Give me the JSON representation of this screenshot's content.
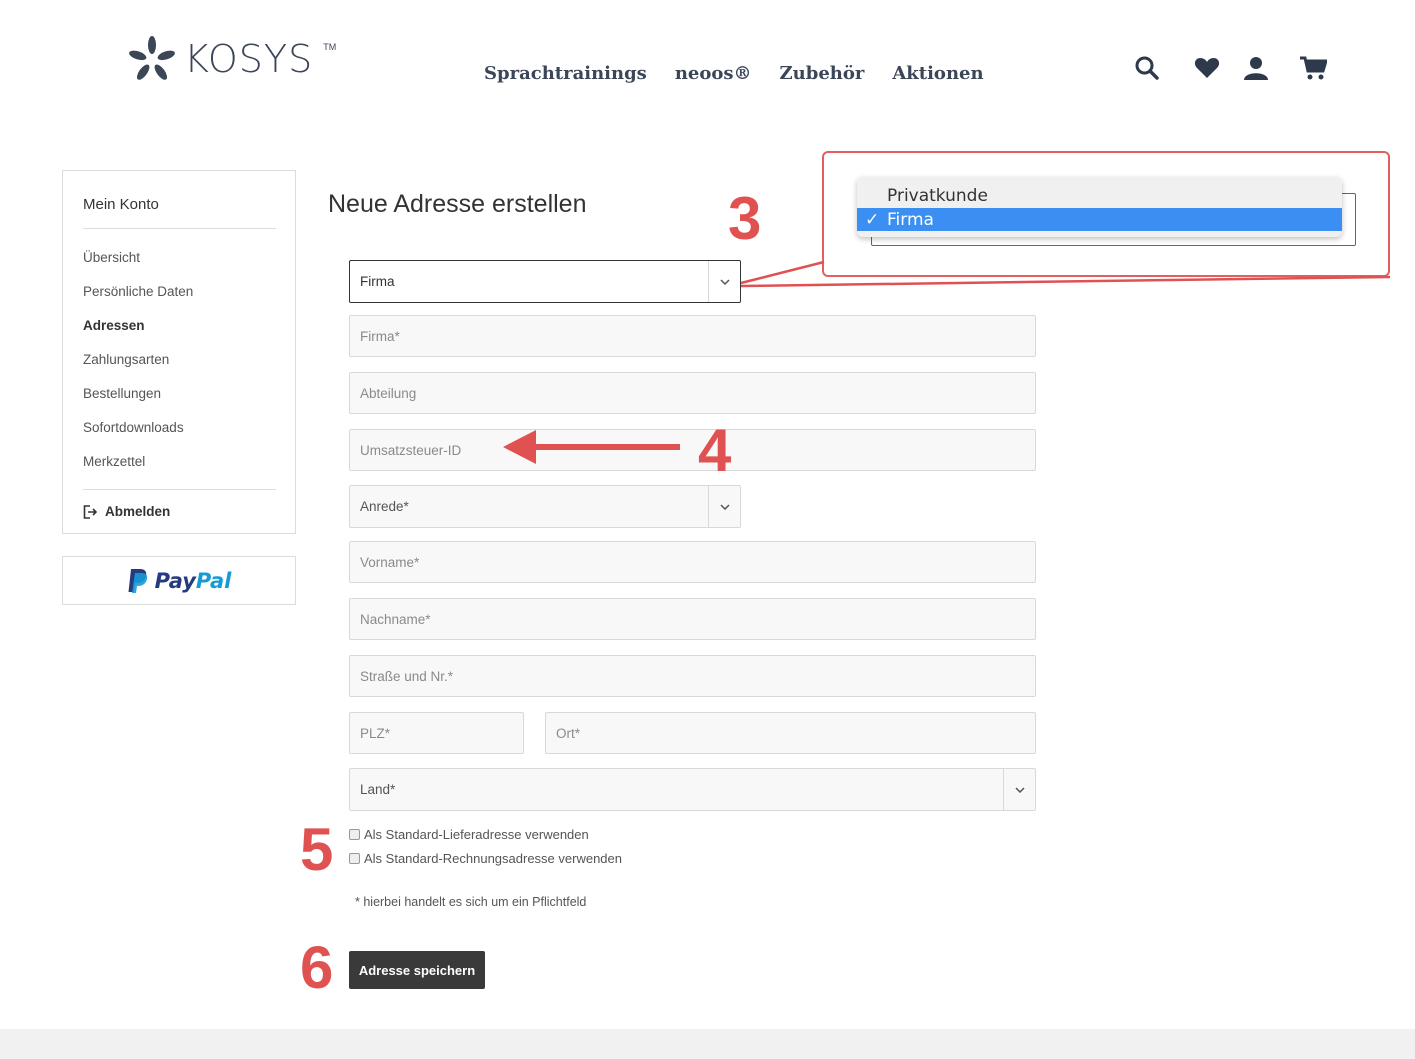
{
  "header": {
    "brand": "KOSYS",
    "brand_tm": "TM",
    "nav": [
      "Sprachtrainings",
      "neoos®",
      "Zubehör",
      "Aktionen"
    ],
    "icons": [
      "search-icon",
      "heart-icon",
      "user-icon",
      "cart-icon"
    ],
    "brand_color": "#3b4657"
  },
  "sidebar": {
    "title": "Mein Konto",
    "items": [
      {
        "label": "Übersicht",
        "active": false
      },
      {
        "label": "Persönliche Daten",
        "active": false
      },
      {
        "label": "Adressen",
        "active": true
      },
      {
        "label": "Zahlungsarten",
        "active": false
      },
      {
        "label": "Bestellungen",
        "active": false
      },
      {
        "label": "Sofortdownloads",
        "active": false
      },
      {
        "label": "Merkzettel",
        "active": false
      }
    ],
    "logout": "Abmelden",
    "paypal": {
      "pay": "Pay",
      "pal": "Pal"
    }
  },
  "form": {
    "title": "Neue Adresse erstellen",
    "customer_type": "Firma",
    "fields": {
      "company": "Firma*",
      "department": "Abteilung",
      "vat_id": "Umsatzsteuer-ID",
      "salutation": "Anrede*",
      "first_name": "Vorname*",
      "last_name": "Nachname*",
      "street": "Straße und Nr.*",
      "zip": "PLZ*",
      "city": "Ort*",
      "country": "Land*"
    },
    "checkbox_shipping": "Als Standard-Lieferadresse verwenden",
    "checkbox_billing": "Als Standard-Rechnungsadresse verwenden",
    "required_note": "* hierbei handelt es sich um ein Pflichtfeld",
    "save_label": "Adresse speichern"
  },
  "annotations": {
    "step3": "3",
    "step4": "4",
    "step5": "5",
    "step6": "6",
    "color": "#e05252",
    "dropdown_options": [
      {
        "label": "Privatkunde",
        "selected": false
      },
      {
        "label": "Firma",
        "selected": true
      }
    ],
    "check_mark": "✓"
  }
}
